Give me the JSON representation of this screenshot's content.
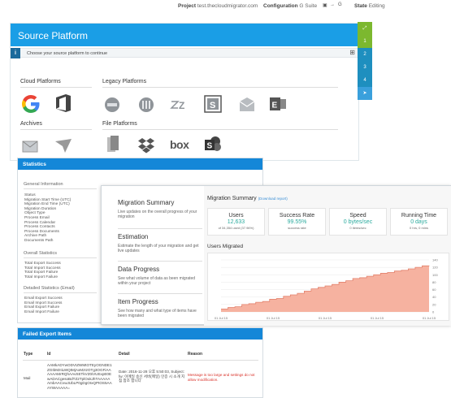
{
  "topbar": {
    "project_label": "Project",
    "project_value": "test.thecloudmigrator.com",
    "config_label": "Configuration",
    "config_value": "G Suite",
    "state_label": "State",
    "state_value": "Editing"
  },
  "source_platform": {
    "title": "Source Platform",
    "info": "Choose your source platform to continue",
    "cloud_title": "Cloud Platforms",
    "legacy_title": "Legacy Platforms",
    "archives_title": "Archives",
    "file_title": "File Platforms",
    "box_logo_text": "box"
  },
  "steps": [
    {
      "label": "⤢",
      "color": "#7cb82f"
    },
    {
      "label": "1",
      "color": "#7cb82f"
    },
    {
      "label": "2",
      "color": "#1e8fbf"
    },
    {
      "label": "3",
      "color": "#1e8fbf"
    },
    {
      "label": "4",
      "color": "#1e8fbf"
    },
    {
      "label": "➤",
      "color": "#3aa0dc"
    }
  ],
  "statistics": {
    "title": "Statistics",
    "general_title": "General Information",
    "general_items": [
      "Status",
      "Migration Start Time (UTC)",
      "Migration End Time (UTC)",
      "Migration Duration",
      "Object Type",
      "Process Email",
      "Process Calendar",
      "Process Contacts",
      "Process Documents",
      "Archive Path",
      "Documents Path"
    ],
    "overall_title": "Overall Statistics",
    "overall_items": [
      "Total Export Success",
      "Total Import Success",
      "Total Export Failure",
      "Total Import Failure"
    ],
    "detailed_title": "Detailed Statistics (Email)",
    "detailed_items": [
      "Email Export Success",
      "Email Import Success",
      "Email Export Failure",
      "Email Import Failure"
    ]
  },
  "migration": {
    "nav": [
      {
        "title": "Migration Summary",
        "desc": "Live updates on the overall progress of your migration"
      },
      {
        "title": "Estimation",
        "desc": "Estimate the length of your migration and get live updates"
      },
      {
        "title": "Data Progress",
        "desc": "See what volume of data as been migrated within your project"
      },
      {
        "title": "Item Progress",
        "desc": "See how many and what type of items have been migrated"
      }
    ],
    "summary_title": "Migration Summary",
    "download_report": "(Download report)",
    "cards": [
      {
        "title": "Users",
        "value": "12,633",
        "sub": "of 34,354 used (37.96%)"
      },
      {
        "title": "Success Rate",
        "value": "99.55%",
        "sub": "success rate"
      },
      {
        "title": "Speed",
        "value": "0 bytes/sec",
        "sub": "0 items/sec"
      },
      {
        "title": "Running Time",
        "value": "0 days",
        "sub": "0 hrs, 0 mins"
      }
    ],
    "users_migrated_title": "Users Migrated"
  },
  "chart_data": {
    "type": "area",
    "title": "Users Migrated",
    "x": [
      0,
      1,
      2,
      3,
      4,
      5,
      6,
      7,
      8,
      9,
      10,
      11,
      12,
      13,
      14,
      15,
      16,
      17,
      18,
      19,
      20,
      21,
      22,
      23,
      24,
      25,
      26,
      27,
      28,
      29,
      30
    ],
    "values": [
      8,
      12,
      14,
      20,
      22,
      26,
      28,
      34,
      36,
      42,
      46,
      50,
      56,
      62,
      66,
      70,
      74,
      80,
      84,
      90,
      92,
      96,
      100,
      104,
      106,
      110,
      112,
      116,
      120,
      124,
      125
    ],
    "x_tick_labels": [
      "01 Jul 15",
      "01 Jul 15",
      "01 Jul 15",
      "01 Jul 15",
      "01 Jul 15"
    ],
    "y_tick_labels": [
      "0",
      "20",
      "40",
      "60",
      "80",
      "100",
      "120",
      "140"
    ],
    "ylim": [
      0,
      140
    ],
    "fill_color": "#f6b2a0",
    "line_color": "#e3826d",
    "grid": true
  },
  "failed_export": {
    "title": "Failed Export Items",
    "headers": [
      "Type",
      "Id",
      "Detail",
      "Reason"
    ],
    "row": {
      "type": "Mail",
      "id": "AAMkADYwODVIZWMtOTEyOGNDE1ZGIbMzIiLWQtMjAxMzIzOTg3OGFiAAAAAAMrRQhAAvSETkVZ0iVUExpE0EwADACgesoBdTZ2TplOokJhTAAAAAAmbAACvwJUbLP0gDgOIxQPtOS5AAAYWAAAAA=",
      "detail": "Date: 2016-11-28 오후 5:50:03, Subject: fw: 이메일 송신 서버(메일) 인증 시 소개 지침 참조 합니다",
      "reason": "Message is too large and settings do not allow modification."
    }
  }
}
